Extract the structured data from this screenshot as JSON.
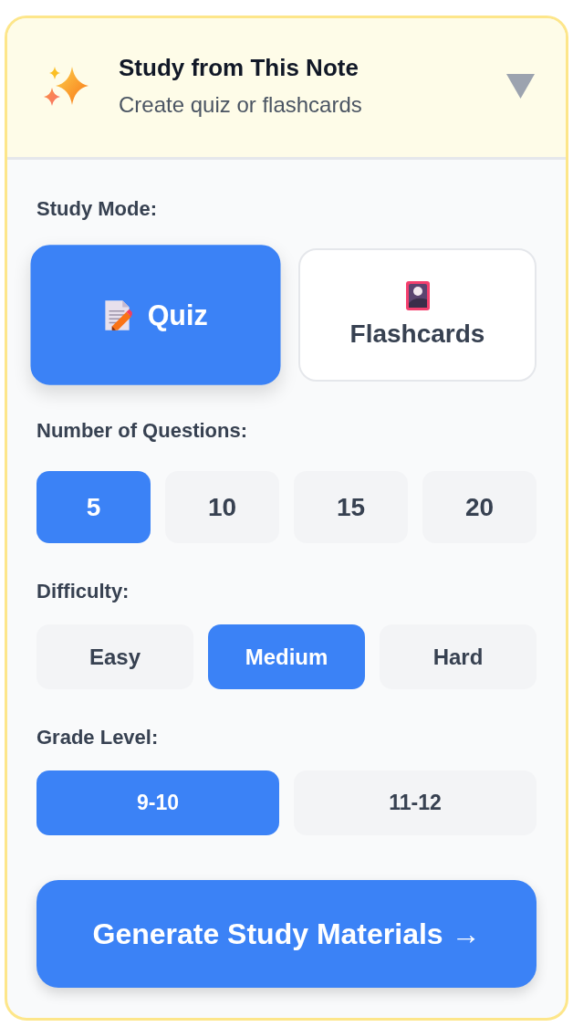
{
  "header": {
    "title": "Study from This Note",
    "subtitle": "Create quiz or flashcards",
    "expanded": true
  },
  "study_mode": {
    "label": "Study Mode:",
    "options": [
      {
        "label": "Quiz",
        "kind": "quiz",
        "selected": true
      },
      {
        "label": "Flashcards",
        "kind": "flashcards",
        "selected": false
      }
    ]
  },
  "question_count": {
    "label": "Number of Questions:",
    "options": [
      {
        "label": "5",
        "selected": true
      },
      {
        "label": "10",
        "selected": false
      },
      {
        "label": "15",
        "selected": false
      },
      {
        "label": "20",
        "selected": false
      }
    ]
  },
  "difficulty": {
    "label": "Difficulty:",
    "options": [
      {
        "label": "Easy",
        "selected": false
      },
      {
        "label": "Medium",
        "selected": true
      },
      {
        "label": "Hard",
        "selected": false
      }
    ]
  },
  "grade_level": {
    "label": "Grade Level:",
    "options": [
      {
        "label": "9-10",
        "selected": true
      },
      {
        "label": "11-12",
        "selected": false
      }
    ]
  },
  "generate_button": {
    "label": "Generate Study Materials →"
  }
}
